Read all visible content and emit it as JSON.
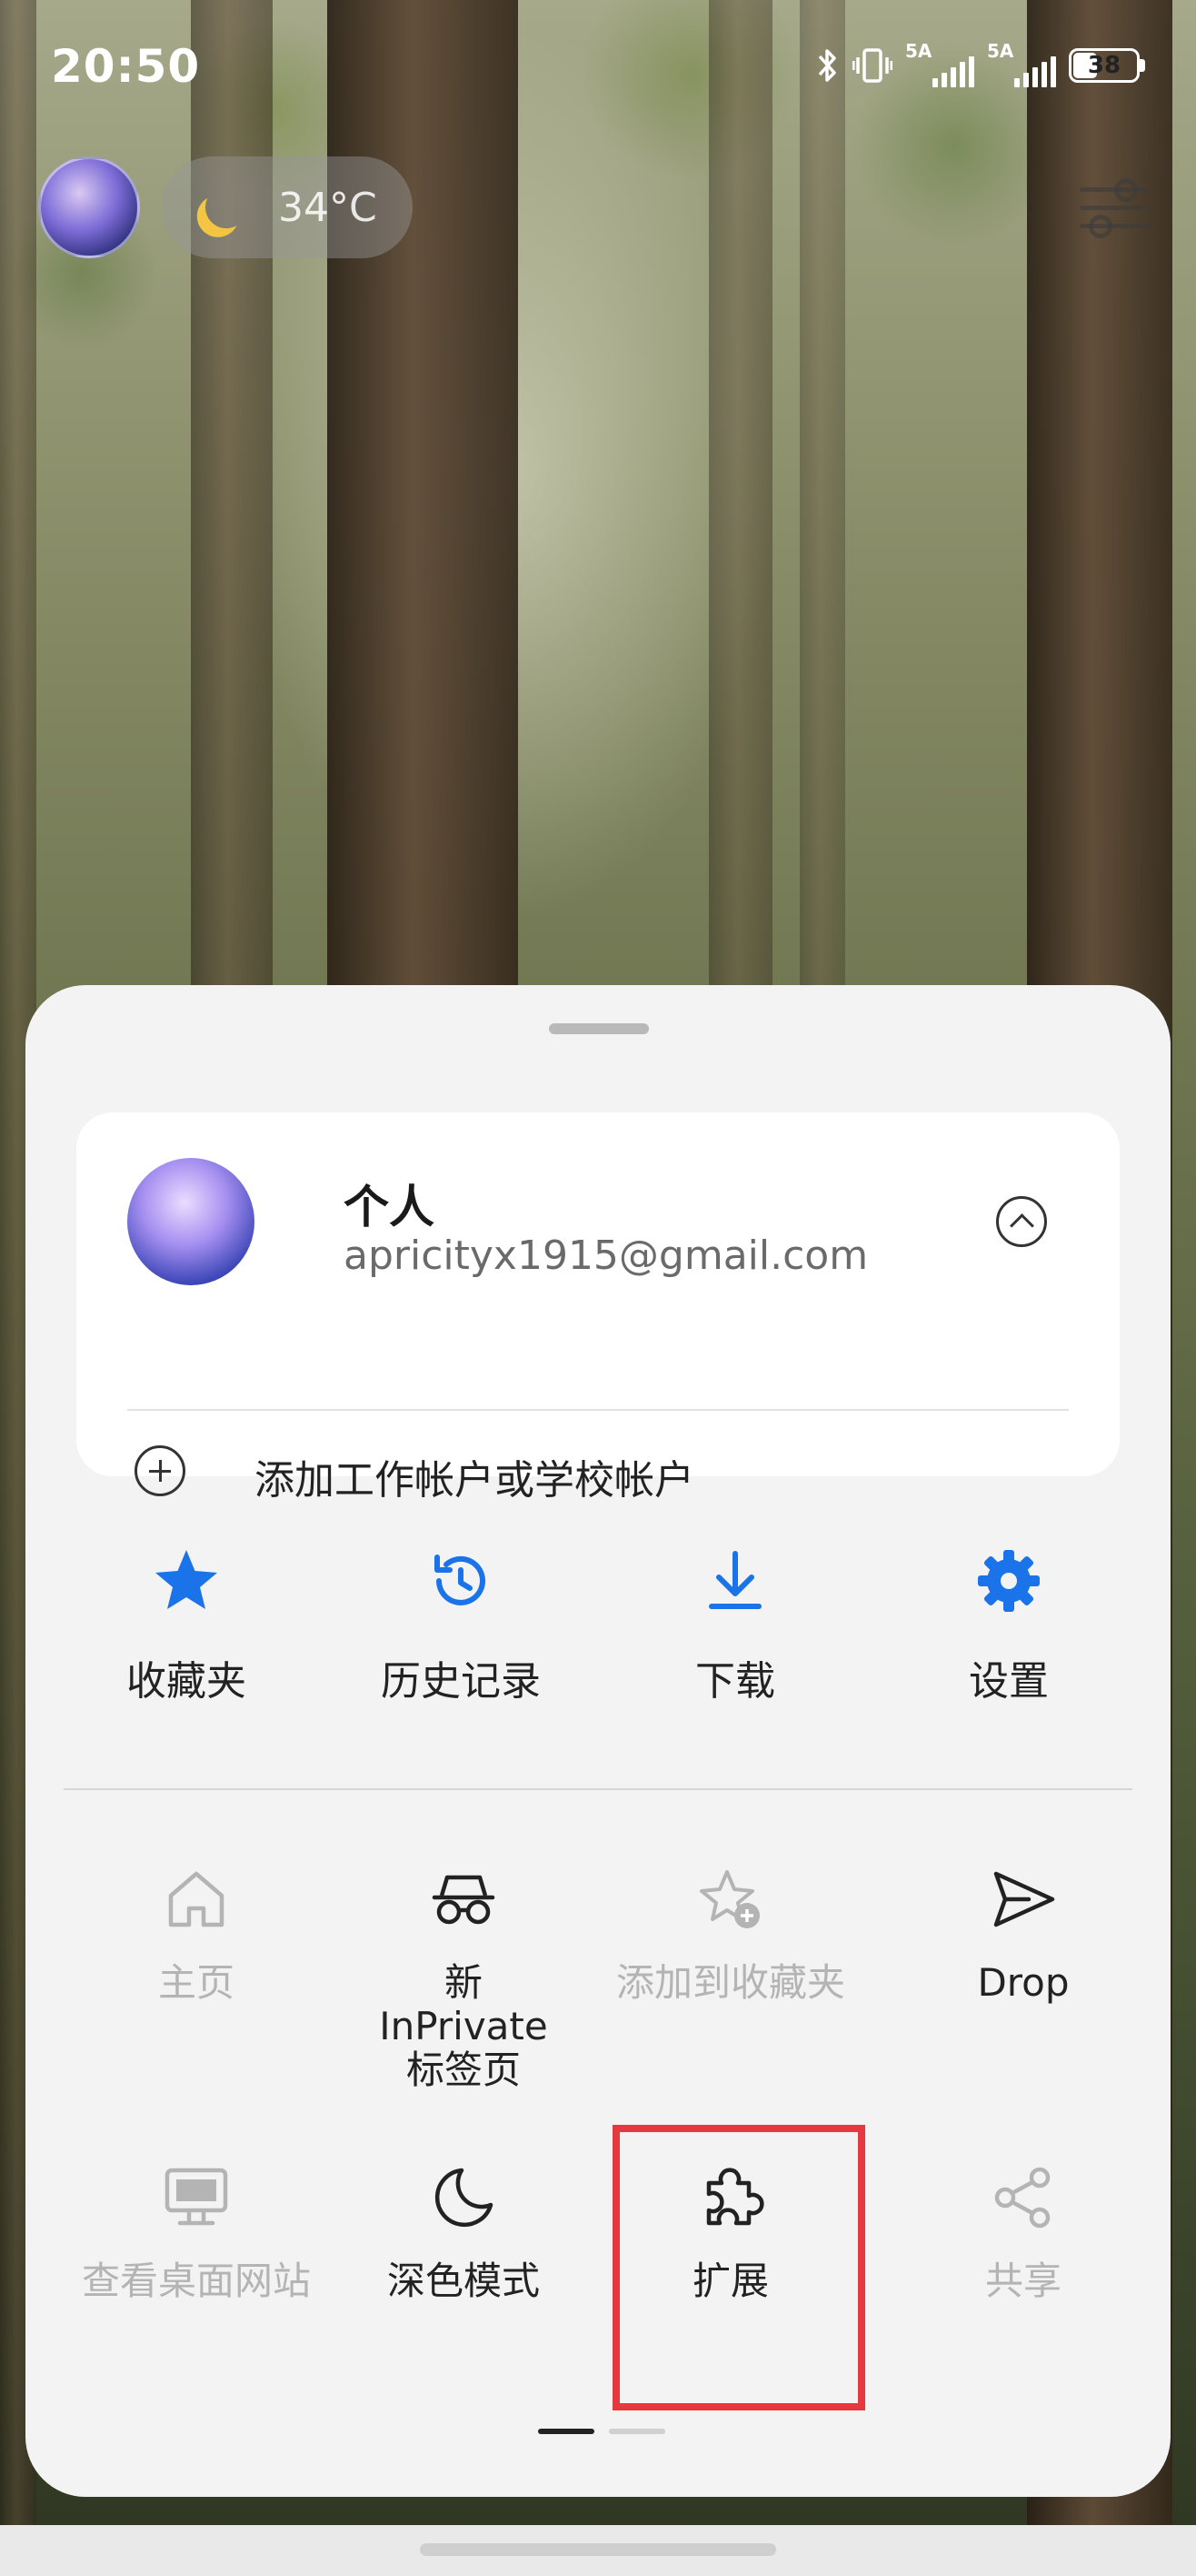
{
  "status_bar": {
    "time": "20:50",
    "signal1_label": "5A",
    "signal2_label": "5A",
    "battery": "38"
  },
  "header": {
    "weather_temp": "34°C"
  },
  "account": {
    "name": "个人",
    "email": "apricityx1915@gmail.com",
    "add_account_label": "添加工作帐户或学校帐户"
  },
  "quick_actions": [
    {
      "label": "收藏夹",
      "icon": "star-icon"
    },
    {
      "label": "历史记录",
      "icon": "history-icon"
    },
    {
      "label": "下载",
      "icon": "download-icon"
    },
    {
      "label": "设置",
      "icon": "gear-icon"
    }
  ],
  "grid": [
    {
      "label": "主页",
      "icon": "home-icon",
      "enabled": false
    },
    {
      "label": "新 InPrivate 标签页",
      "icon": "inprivate-icon",
      "enabled": true
    },
    {
      "label": "添加到收藏夹",
      "icon": "add-favorite-icon",
      "enabled": false
    },
    {
      "label": "Drop",
      "icon": "send-icon",
      "enabled": true
    },
    {
      "label": "查看桌面网站",
      "icon": "desktop-icon",
      "enabled": false
    },
    {
      "label": "深色模式",
      "icon": "moon-icon",
      "enabled": true
    },
    {
      "label": "扩展",
      "icon": "puzzle-icon",
      "enabled": true
    },
    {
      "label": "共享",
      "icon": "share-icon",
      "enabled": false
    }
  ],
  "colors": {
    "accent": "#1a73e8",
    "highlight": "#e5393f"
  }
}
